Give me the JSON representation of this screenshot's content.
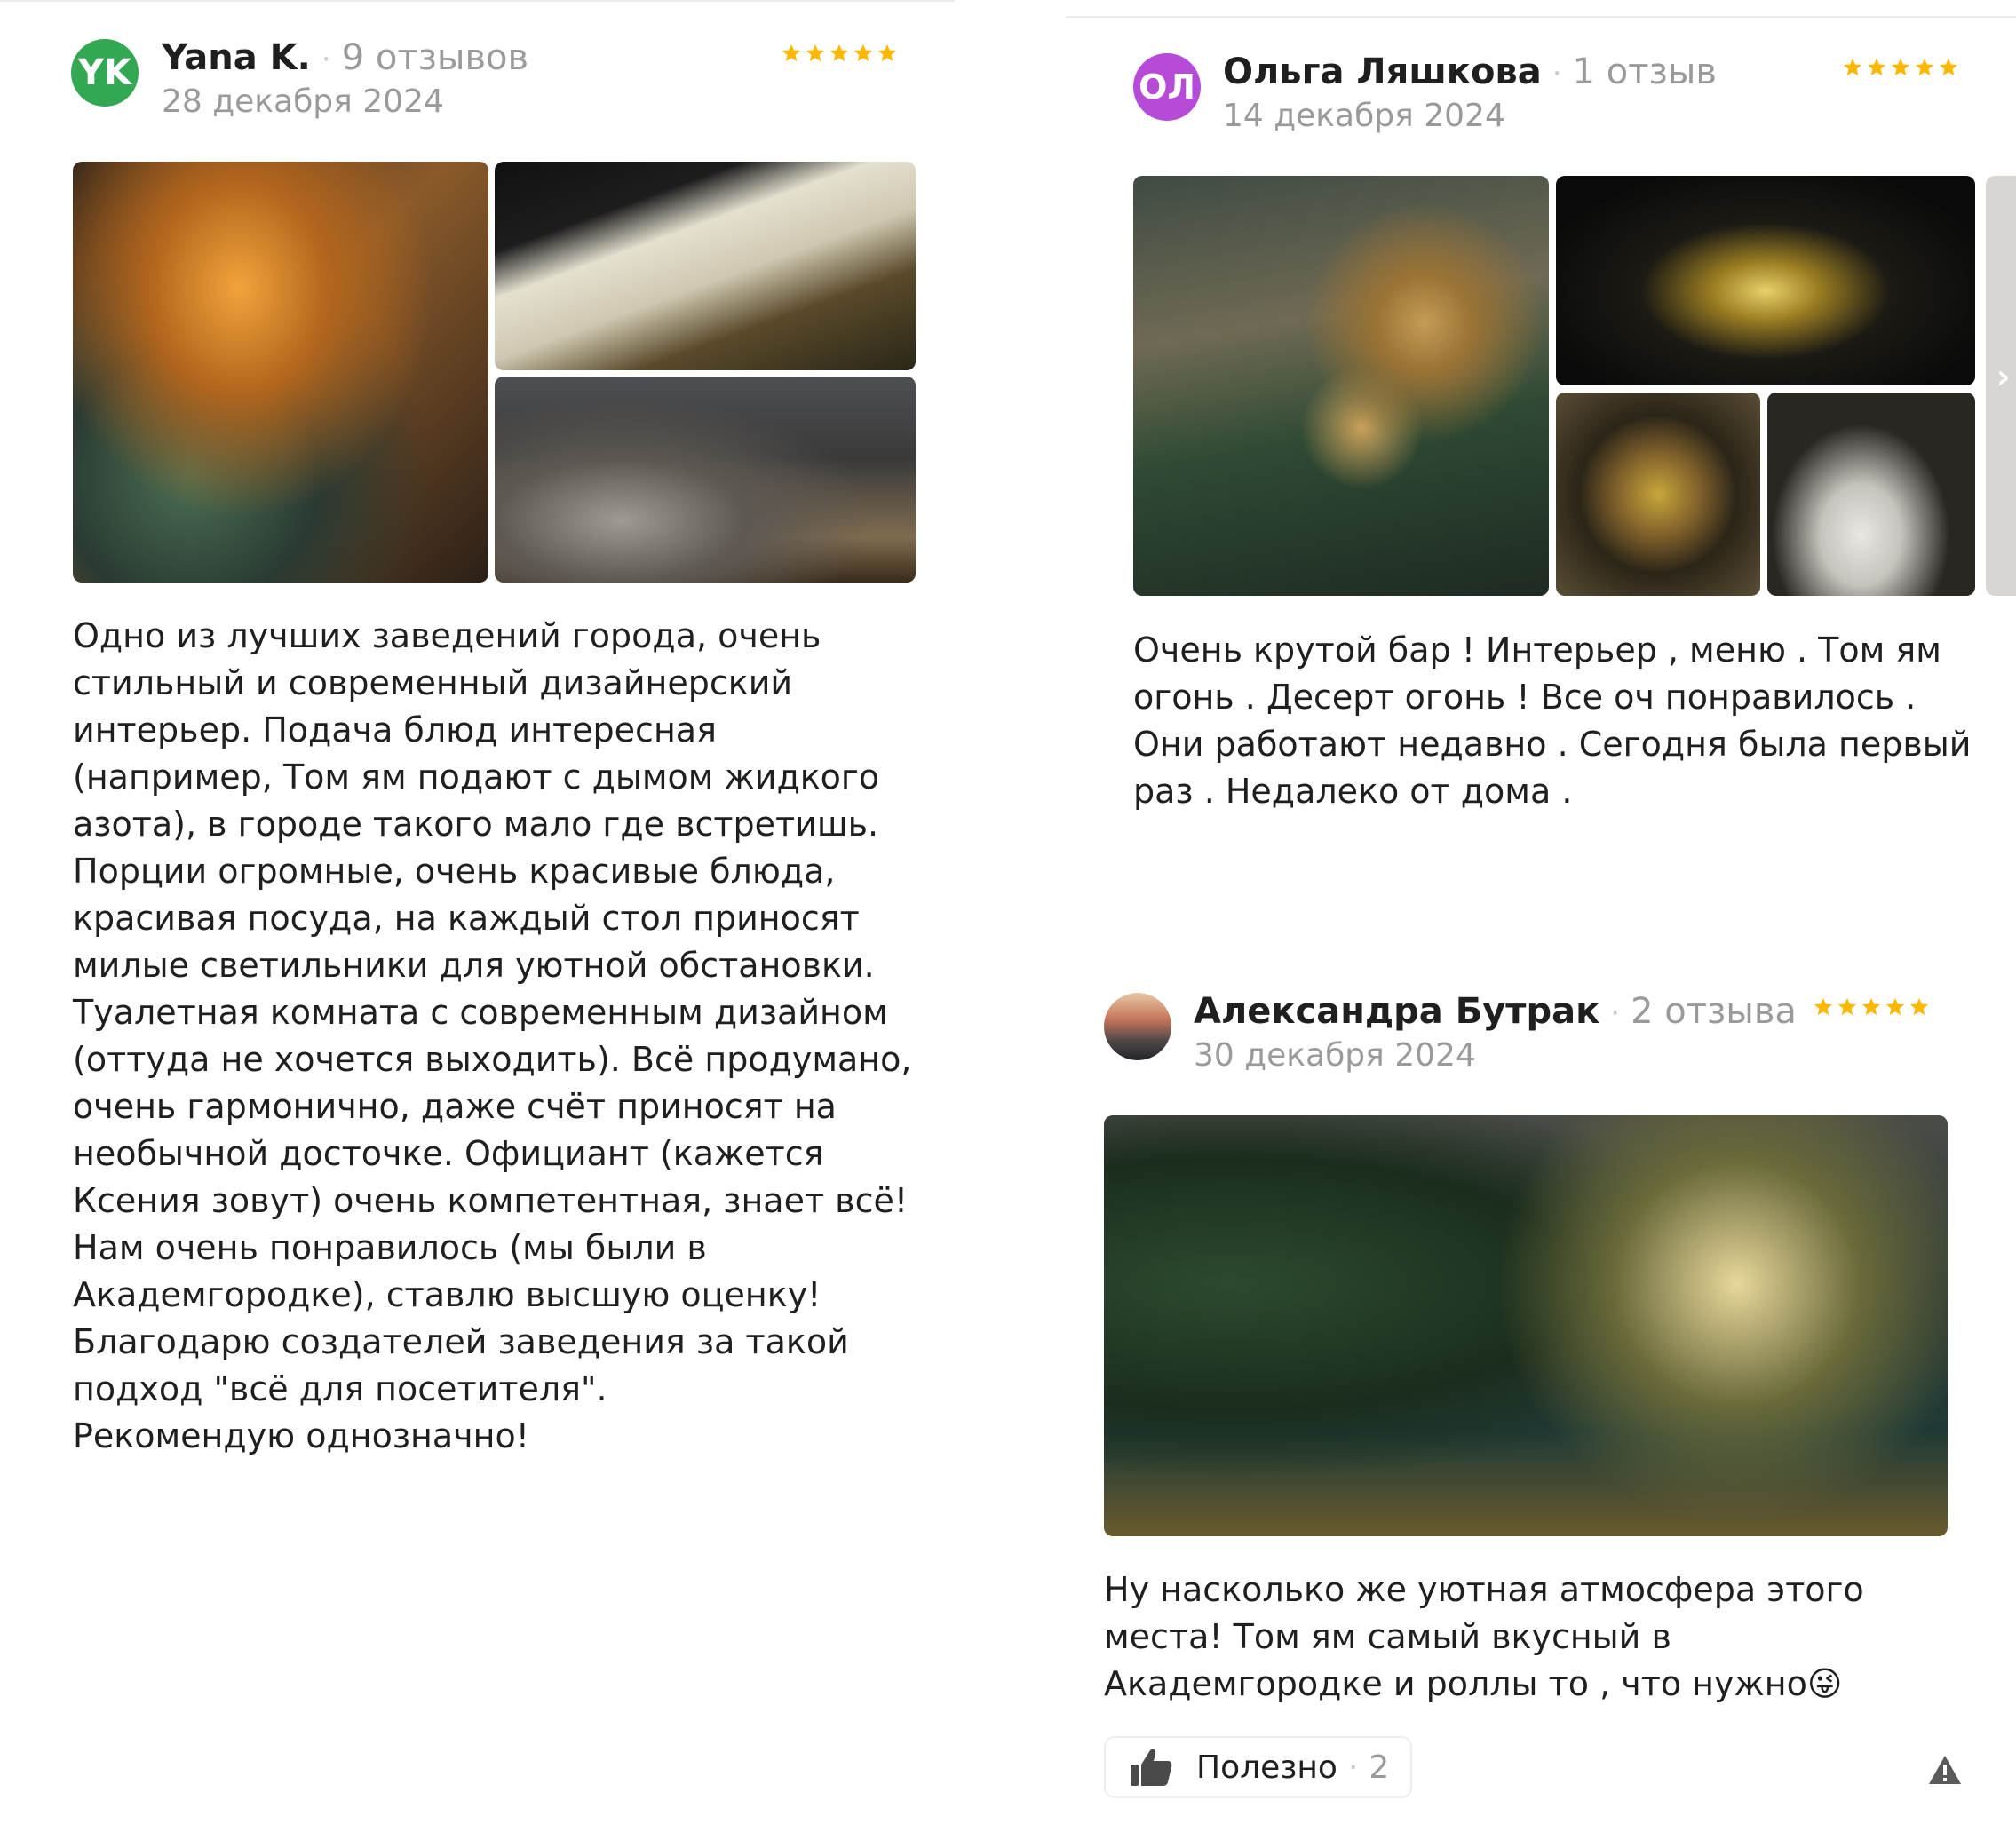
{
  "colors": {
    "star": "#fcb800",
    "avatar_yk": "#33a853",
    "avatar_ol": "#b54bd6",
    "muted_text": "#9a9a9a"
  },
  "reviews": [
    {
      "author": "Yana K.",
      "avatar_initials": "YK",
      "reviews_count": "9 отзывов",
      "date": "28 декабря 2024",
      "rating": 5,
      "photos": [
        "food-table-photo",
        "menu-card-photo",
        "restroom-sinks-photo"
      ],
      "text": "Одно из лучших заведений города, очень\nстильный и современный дизайнерский\nинтерьер. Подача блюд интересная\n(например, Том ям подают с дымом жидкого\nазота), в городе такого мало где встретишь.\nПорции огромные, очень красивые блюда,\nкрасивая посуда, на каждый стол приносят\nмилые светильники для уютной обстановки.\nТуалетная комната с современным дизайном\n(оттуда не хочется выходить). Всё продумано,\nочень гармонично, даже счёт приносят на\nнеобычной досточке. Официант (кажется\nКсения зовут) очень компетентная, знает всё!\nНам очень понравилось (мы были в\nАкадемгородке), ставлю высшую оценку!\nБлагодарю создателей заведения за такой\nподход \"всё для посетителя\".\nРекомендую однозначно!"
    },
    {
      "author": "Ольга Ляшкова",
      "avatar_initials": "ОЛ",
      "reviews_count": "1 отзыв",
      "date": "14 декабря 2024",
      "rating": 5,
      "photos": [
        "christmas-tree-photo",
        "golden-leaf-plate-photo",
        "dessert-plate-photo",
        "smoke-dish-photo"
      ],
      "text": "Очень крутой бар ! Интерьер , меню . Том ям\nогонь . Десерт огонь ! Все оч понравилось .\nОни работают недавно . Сегодня была первый\nраз . Недалеко от дома ."
    },
    {
      "author": "Александра Бутрак",
      "reviews_count": "2 отзыва",
      "date": "30 декабря 2024",
      "rating": 5,
      "photos": [
        "interior-christmas-photo"
      ],
      "text": "Ну насколько же уютная атмосфера этого\nместа! Том ям самый вкусный в\nАкадемгородке и роллы то , что нужно😜",
      "helpful_label": "Полезно",
      "helpful_count": "2"
    }
  ],
  "icons": {
    "thumb": "thumbs-up-icon",
    "warning": "warning-icon",
    "next": "chevron-right-icon"
  }
}
